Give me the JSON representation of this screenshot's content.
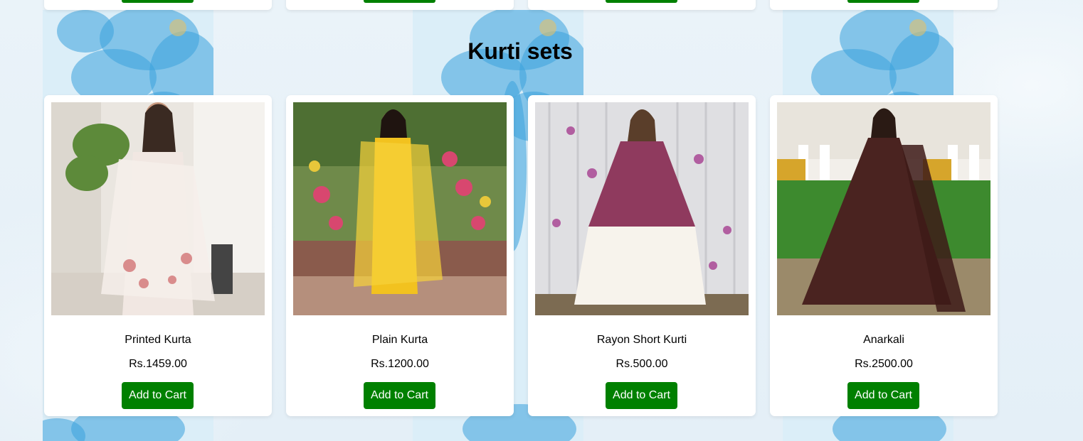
{
  "section": {
    "title": "Kurti sets"
  },
  "colors": {
    "button": "#008000",
    "button_text": "#ffffff",
    "card": "#ffffff",
    "flower": "#3aa3dc"
  },
  "products": [
    {
      "name": "Printed Kurta",
      "price": "Rs.1459.00",
      "button": "Add to Cart",
      "image": "woman-white-printed-kurta-photo"
    },
    {
      "name": "Plain Kurta",
      "price": "Rs.1200.00",
      "button": "Add to Cart",
      "image": "woman-yellow-kurta-photo"
    },
    {
      "name": "Rayon Short Kurti",
      "price": "Rs.500.00",
      "button": "Add to Cart",
      "image": "woman-maroon-short-kurti-photo"
    },
    {
      "name": "Anarkali",
      "price": "Rs.2500.00",
      "button": "Add to Cart",
      "image": "woman-brown-anarkali-photo"
    }
  ]
}
